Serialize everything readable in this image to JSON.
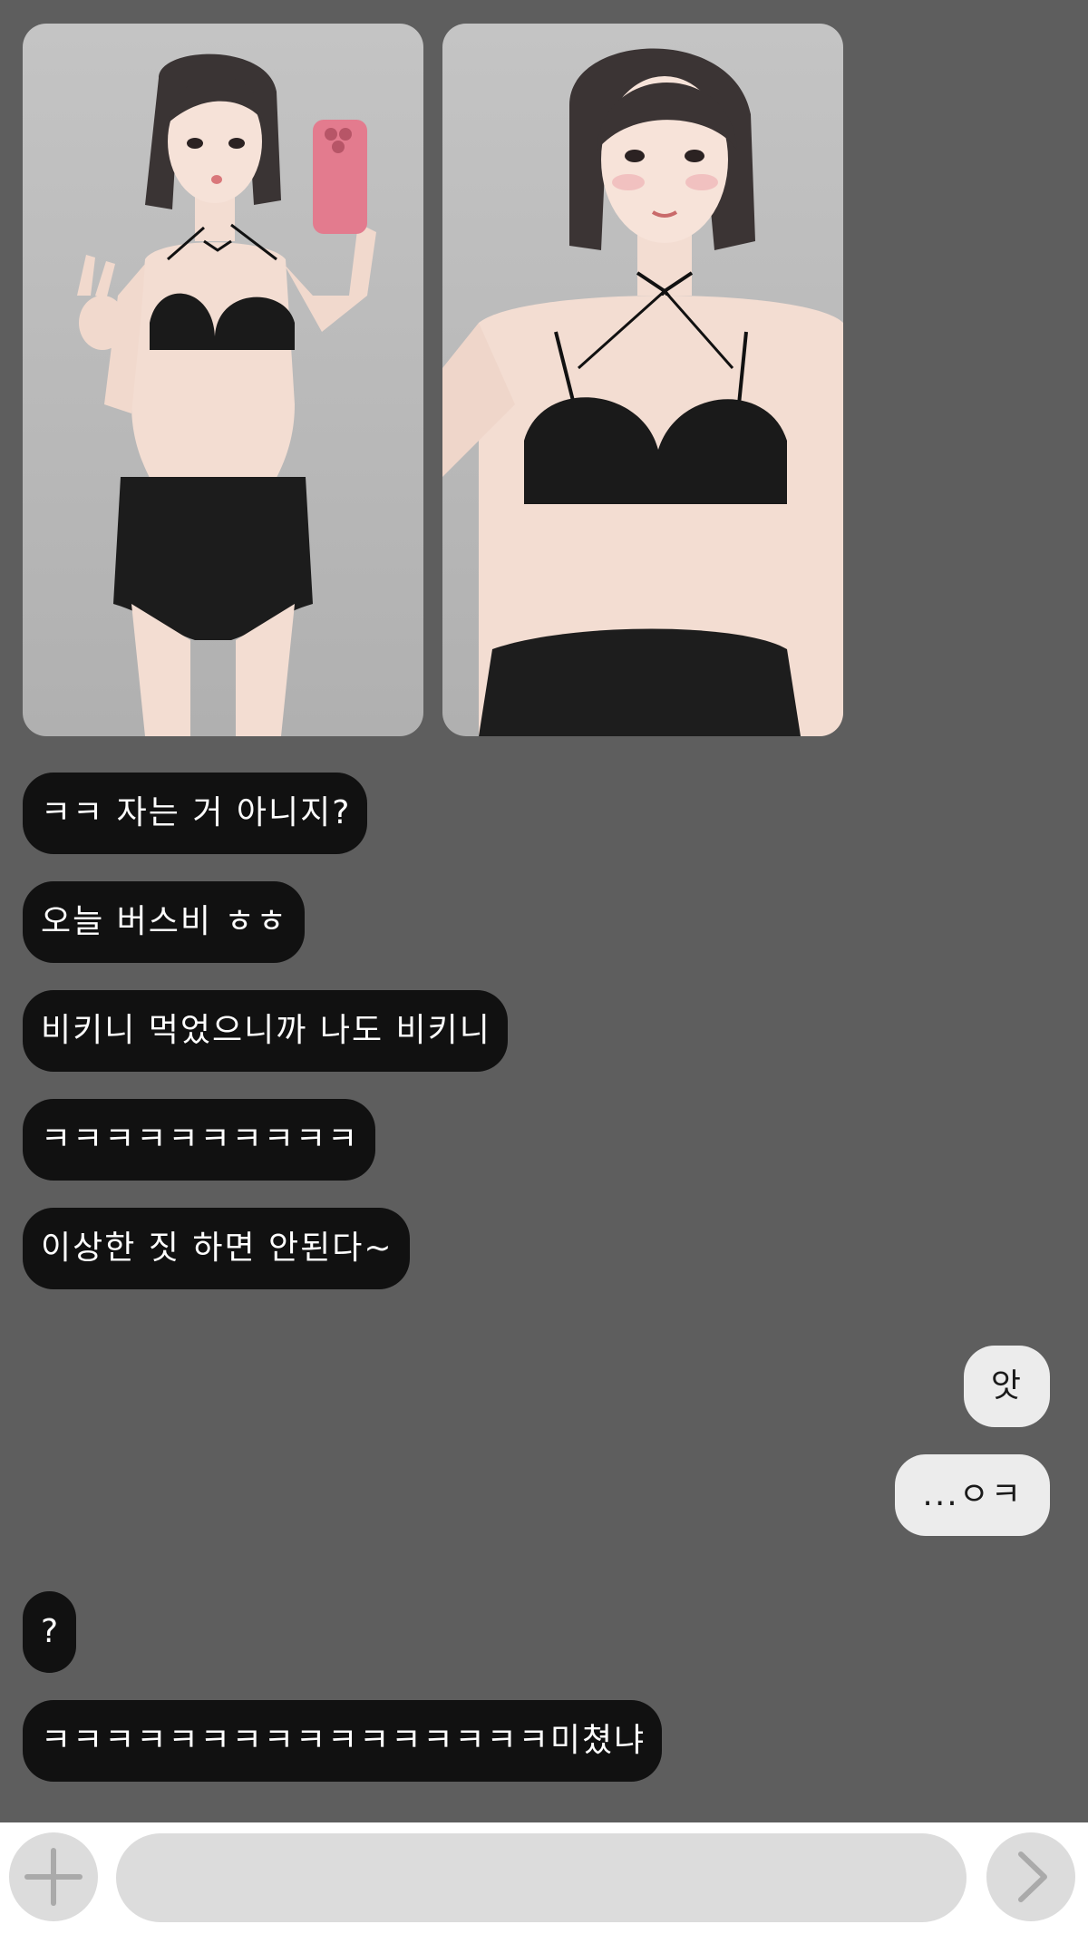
{
  "photos": [
    {
      "alt_name": "selfie-photo-1"
    },
    {
      "alt_name": "selfie-photo-2"
    }
  ],
  "messages": [
    {
      "side": "in",
      "text": "ㅋㅋ 자는 거 아니지?"
    },
    {
      "side": "in",
      "text": "오늘 버스비 ㅎㅎ"
    },
    {
      "side": "in",
      "text": "비키니 먹었으니까 나도 비키니"
    },
    {
      "side": "in",
      "text": "ㅋㅋㅋㅋㅋㅋㅋㅋㅋㅋ"
    },
    {
      "side": "in",
      "text": "이상한 짓 하면 안된다~"
    },
    {
      "side": "out",
      "text": "앗"
    },
    {
      "side": "out",
      "text": "...ㅇㅋ"
    },
    {
      "side": "in",
      "text": "?"
    },
    {
      "side": "in",
      "text": "ㅋㅋㅋㅋㅋㅋㅋㅋㅋㅋㅋㅋㅋㅋㅋㅋ미쳤냐"
    }
  ],
  "composer": {
    "input_value": "",
    "add_icon": "plus-icon",
    "send_icon": "chevron-right-icon"
  },
  "colors": {
    "background": "#5e5e5e",
    "incoming_bubble": "#111111",
    "outgoing_bubble": "#ececec",
    "composer_bar": "#ffffff",
    "composer_controls": "#dcdcdc"
  }
}
